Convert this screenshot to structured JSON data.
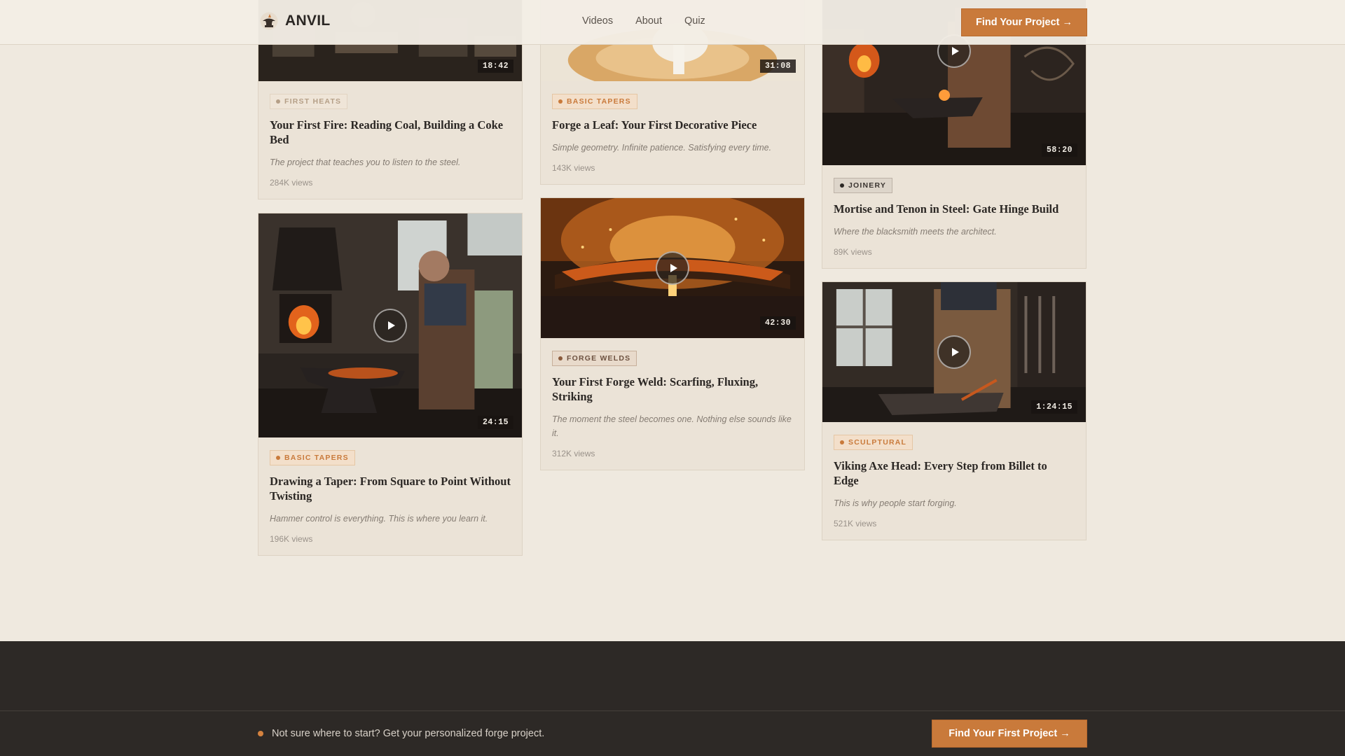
{
  "header": {
    "brand": "ANVIL",
    "nav": [
      "Videos",
      "About",
      "Quiz"
    ],
    "cta": "Find Your Project →"
  },
  "cards": [
    {
      "duration": "18:42",
      "tag": "FIRST HEATS",
      "title": "Your First Fire: Reading Coal, Building a Coke Bed",
      "desc": "The project that teaches you to listen to the steel.",
      "views": "284K views"
    },
    {
      "duration": "24:15",
      "tag": "BASIC TAPERS",
      "title": "Drawing a Taper: From Square to Point Without Twisting",
      "desc": "Hammer control is everything. This is where you learn it.",
      "views": "196K views"
    },
    {
      "duration": "31:08",
      "tag": "BASIC TAPERS",
      "title": "Forge a Leaf: Your First Decorative Piece",
      "desc": "Simple geometry. Infinite patience. Satisfying every time.",
      "views": "143K views"
    },
    {
      "duration": "42:30",
      "tag": "FORGE WELDS",
      "title": "Your First Forge Weld: Scarfing, Fluxing, Striking",
      "desc": "The moment the steel becomes one. Nothing else sounds like it.",
      "views": "312K views"
    },
    {
      "duration": "58:20",
      "tag": "JOINERY",
      "title": "Mortise and Tenon in Steel: Gate Hinge Build",
      "desc": "Where the blacksmith meets the architect.",
      "views": "89K views"
    },
    {
      "duration": "1:24:15",
      "tag": "SCULPTURAL",
      "title": "Viking Axe Head: Every Step from Billet to Edge",
      "desc": "This is why people start forging.",
      "views": "521K views"
    }
  ],
  "footer": {
    "prompt": "Not sure where to start? Get your personalized forge project.",
    "cta": "Find Your First Project →"
  },
  "colors": {
    "accent": "#c97a3b",
    "background": "#efe9df",
    "footer": "#2d2926"
  }
}
